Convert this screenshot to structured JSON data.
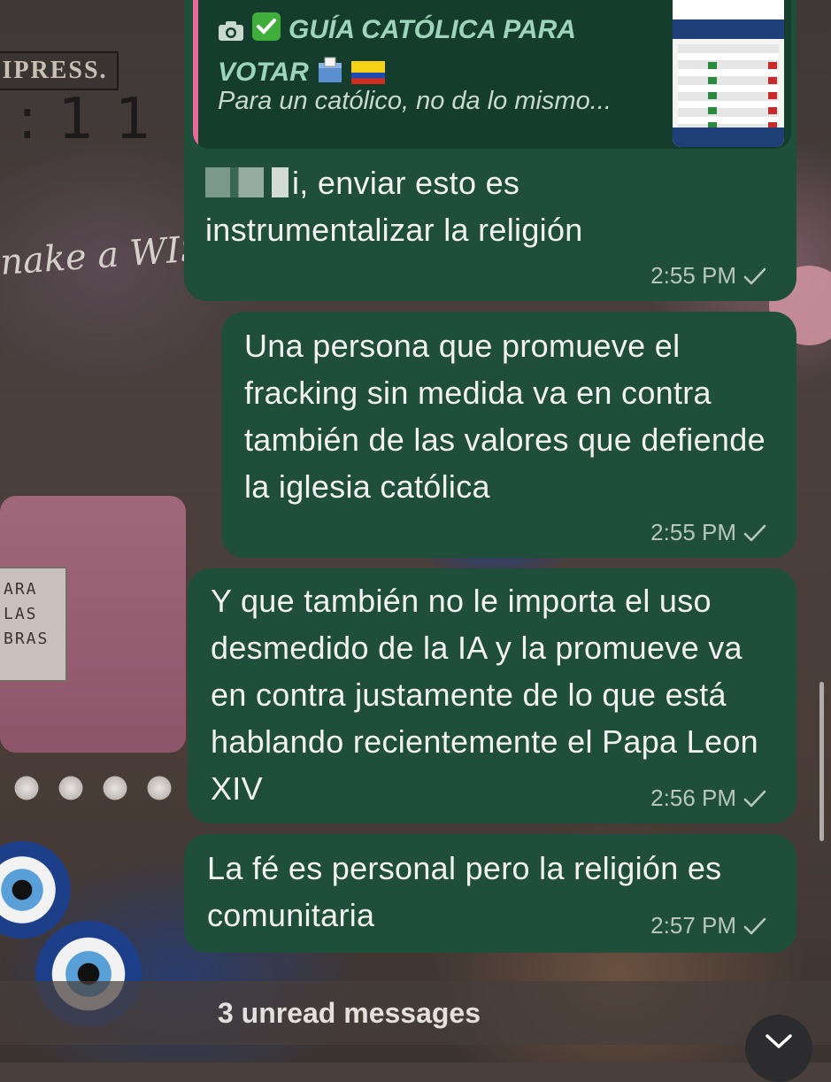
{
  "reply_preview": {
    "title_line1": "GUÍA CATÓLICA PARA",
    "title_line2": "VOTAR",
    "subtitle": "Para un católico, no da lo mismo...",
    "thumbnail_icon": "election-guide-image"
  },
  "messages": [
    {
      "text_line1_suffix": "i, enviar esto es",
      "text_line2": "instrumentalizar la religión",
      "time": "2:55 PM",
      "status": "sent-check-icon"
    },
    {
      "text": "Una persona que promueve el fracking sin medida va en contra también de las valores que defiende la iglesia católica",
      "time": "2:55 PM",
      "status": "sent-check-icon"
    },
    {
      "text": "Y que también no le importa el uso desmedido de la IA y la promueve va en contra justamente de lo que está hablando recientemente el Papa Leon XIV",
      "time": "2:56 PM",
      "status": "sent-check-icon"
    },
    {
      "text": "La fé es personal pero la religión es comunitaria",
      "time": "2:57 PM",
      "status": "sent-check-icon"
    }
  ],
  "unread_banner": "3 unread messages",
  "wallpaper_text": {
    "press": "IPRESS.",
    "time": ":11",
    "make_a_wish": "nake a WISh",
    "label": "ARA LAS BRAS"
  },
  "colors": {
    "bubble": "#1f4e3a",
    "reply_card": "#153d2d",
    "reply_accent": "#e86a9a",
    "reply_title": "#9ed4bd",
    "meta": "#b7c7bf"
  }
}
